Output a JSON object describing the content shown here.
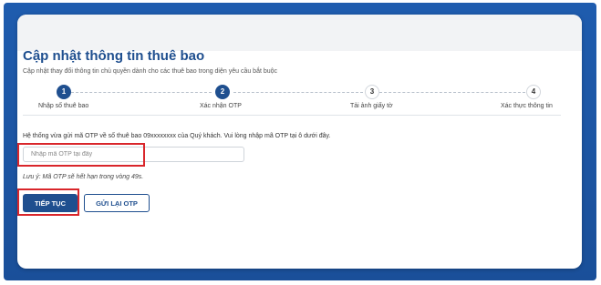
{
  "form": {
    "title": "Cập nhật thông tin thuê bao",
    "subtitle": "Cập nhật thay đổi thông tin chủ quyền dành cho các thuê bao trong diện yêu cầu bắt buộc"
  },
  "steps": [
    {
      "number": "1",
      "label": "Nhập số thuê bao",
      "state": "done"
    },
    {
      "number": "2",
      "label": "Xác nhận OTP",
      "state": "active"
    },
    {
      "number": "3",
      "label": "Tải ảnh giấy tờ",
      "state": "todo"
    },
    {
      "number": "4",
      "label": "Xác thực thông tin",
      "state": "todo"
    }
  ],
  "otp": {
    "info_text": "Hệ thống vừa gửi mã OTP về số thuê bao 09xxxxxxxx của Quý khách. Vui lòng nhập mã OTP tại ô dưới đây.",
    "input_placeholder": "Nhập mã OTP tại đây",
    "input_value": "",
    "note": "Lưu ý: Mã OTP sẽ hết hạn trong vòng 49s."
  },
  "buttons": {
    "continue_label": "TIẾP TỤC",
    "resend_label": "GỬI LẠI OTP"
  },
  "colors": {
    "frame_blue": "#1a4f99",
    "primary": "#1f4f8f",
    "highlight_red": "#d9262b"
  }
}
